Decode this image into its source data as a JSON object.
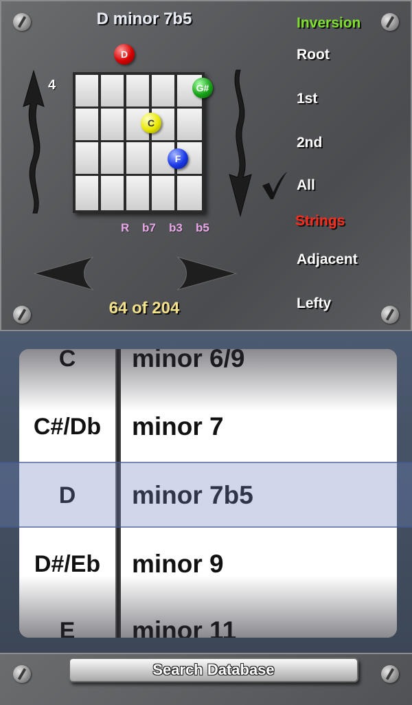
{
  "chord_display": {
    "title": "D minor 7b5",
    "fret_number": "4",
    "notes": [
      {
        "label": "D",
        "color": "#d60000"
      },
      {
        "label": "G#",
        "color": "#17a317"
      },
      {
        "label": "C",
        "color": "#e8e800"
      },
      {
        "label": "F",
        "color": "#1838e8"
      }
    ],
    "intervals": [
      "R",
      "b7",
      "b3",
      "b5"
    ],
    "counter": "64 of 204"
  },
  "options": {
    "inversion_header": "Inversion",
    "inversions": [
      "Root",
      "1st",
      "2nd",
      "All"
    ],
    "selected_inversion": "All",
    "strings_header": "Strings",
    "strings": [
      "Adjacent",
      "Lefty"
    ]
  },
  "picker": {
    "roots": [
      "C",
      "C#/Db",
      "D",
      "D#/Eb",
      "E"
    ],
    "types": [
      "minor 6/9",
      "minor 7",
      "minor 7b5",
      "minor 9",
      "minor 11"
    ],
    "selected_root": "D",
    "selected_type": "minor 7b5"
  },
  "footer": {
    "search_label": "Search Database"
  },
  "icons": {
    "check": "checkmark-icon",
    "arrows": [
      "up-wavy-arrow-icon",
      "down-wavy-arrow-icon",
      "left-arrow-icon",
      "right-arrow-icon"
    ]
  }
}
